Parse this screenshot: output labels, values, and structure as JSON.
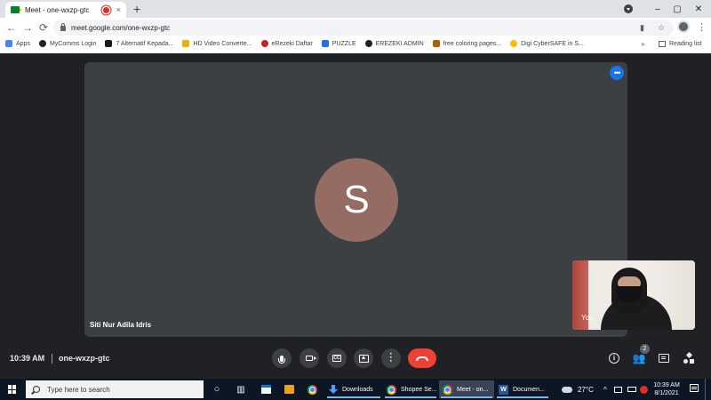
{
  "browser": {
    "tab_title": "Meet - one-wxzp-gtc",
    "tab_close": "×",
    "new_tab": "+",
    "url": "meet.google.com/one-wxzp-gtc",
    "window_controls": {
      "minimize": "–",
      "maximize": "▢",
      "close": "✕"
    },
    "nav": {
      "back": "←",
      "forward": "→",
      "reload": "⟳"
    },
    "omni_icons": {
      "camera": "▮",
      "star": "☆"
    },
    "menu": "⋮",
    "bookmarks": [
      {
        "label": "Apps",
        "icon_color": "#ea4335"
      },
      {
        "label": "MyComms Login",
        "icon_color": "#202124"
      },
      {
        "label": "7 Alternatif Kepada...",
        "icon_color": "#1a1a1a"
      },
      {
        "label": "HD Video Converte...",
        "icon_color": "#f9ab00"
      },
      {
        "label": "eRezeki Daftar",
        "icon_color": "#c5221f"
      },
      {
        "label": "PUZZLE",
        "icon_color": "#1a73e8"
      },
      {
        "label": "EREZEKI ADMIN",
        "icon_color": "#202124"
      },
      {
        "label": "free coloring pages...",
        "icon_color": "#b06000"
      },
      {
        "label": "Digi CyberSAFE in S...",
        "icon_color": "#fbbc04"
      }
    ],
    "bookmarks_more": "»",
    "reading_list": "Reading list"
  },
  "meet": {
    "main_participant": {
      "name": "Siti Nur Adila Idris",
      "initial": "S",
      "avatar_color": "#956c64"
    },
    "tile_menu": "•••",
    "self_view_label": "You",
    "clock": "10:39 AM",
    "meeting_code": "one-wxzp-gtc",
    "controls": {
      "captions_label": "CC",
      "info": "i",
      "people_icon": "👥",
      "participant_count": "2"
    },
    "accent": "#1a73e8",
    "end_call_color": "#ea4335"
  },
  "taskbar": {
    "search_placeholder": "Type here to search",
    "task_view": "▥",
    "cortana": "○",
    "apps": [
      {
        "label": "Downloads",
        "icon": "download-icon"
      },
      {
        "label": "Shopee Se...",
        "icon": "chrome-icon"
      },
      {
        "label": "Meet - on...",
        "icon": "chrome-icon"
      },
      {
        "label": "Documen...",
        "icon": "word-icon"
      }
    ],
    "weather": "27°C",
    "tray_chevron": "^",
    "time": "10:39 AM",
    "date": "8/1/2021"
  }
}
